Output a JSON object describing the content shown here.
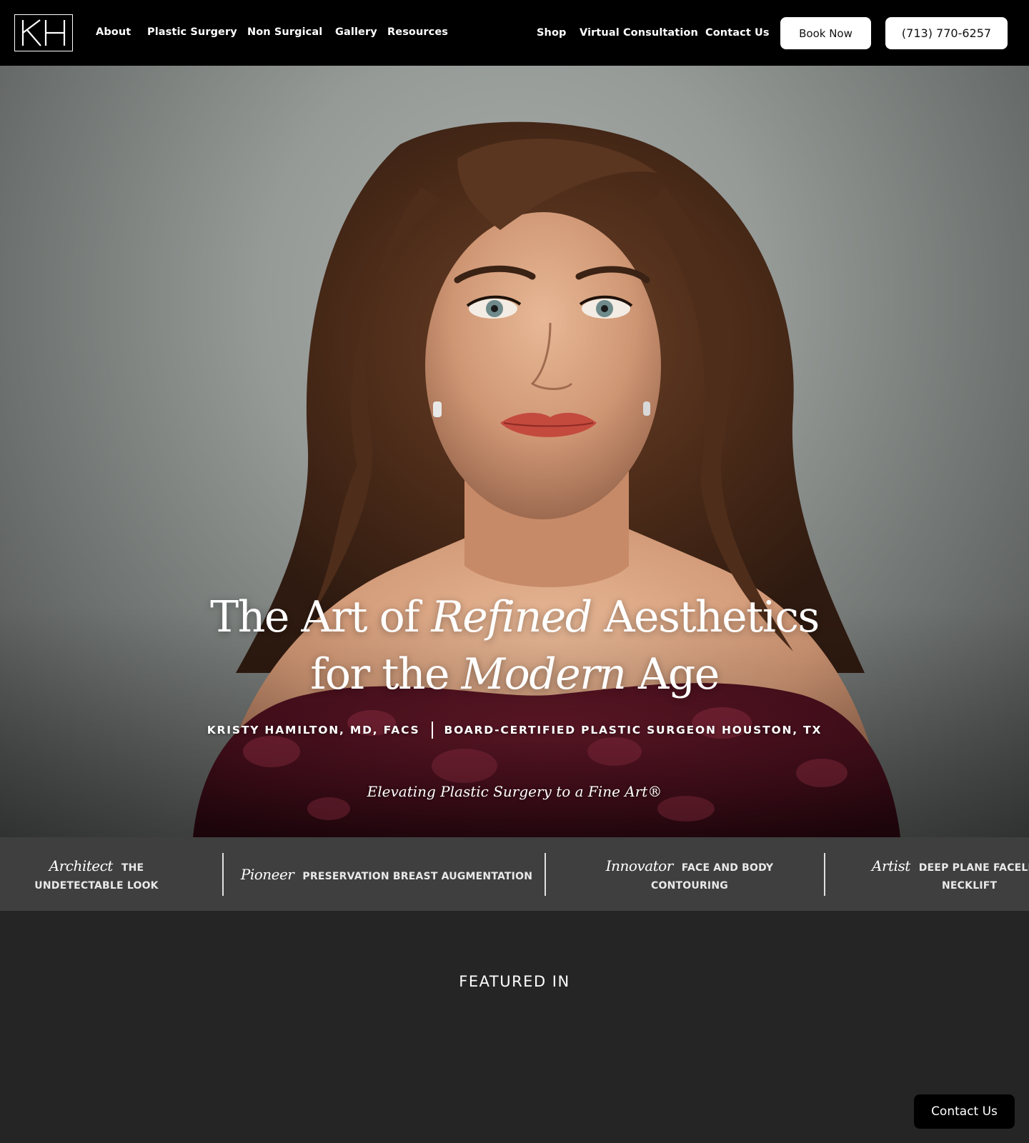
{
  "nav": {
    "logo_text": "KH",
    "links_left": [
      "About",
      "Plastic Surgery",
      "Non Surgical",
      "Gallery",
      "Resources"
    ],
    "links_right": [
      "Shop",
      "Virtual Consultation",
      "Contact Us"
    ],
    "book_label": "Book Now",
    "phone_label": "(713) 770-6257"
  },
  "hero": {
    "title_line1_a": "The Art of ",
    "title_line1_em": "Refined",
    "title_line1_b": " Aesthetics",
    "title_line2_a": "for the ",
    "title_line2_em": "Modern",
    "title_line2_b": " Age",
    "credential_name": "KRISTY HAMILTON, MD, FACS",
    "credential_title": "BOARD-CERTIFIED PLASTIC SURGEON HOUSTON, TX",
    "tagline": "Elevating Plastic Surgery to a Fine Art®"
  },
  "strip": {
    "items": [
      {
        "word": "Architect",
        "desc": "THE",
        "desc2": "UNDETECTABLE LOOK"
      },
      {
        "word": "Pioneer",
        "desc": "PRESERVATION BREAST AUGMENTATION",
        "desc2": ""
      },
      {
        "word": "Innovator",
        "desc": "FACE AND BODY",
        "desc2": "CONTOURING"
      },
      {
        "word": "Artist",
        "desc": "DEEP PLANE FACELIF",
        "desc2": "NECKLIFT"
      }
    ]
  },
  "featured": {
    "heading": "FEATURED IN"
  },
  "floating": {
    "contact_label": "Contact Us"
  },
  "colors": {
    "nav_bg": "#000000",
    "strip_bg": "#3f3f3f",
    "page_bg": "#252525",
    "dress": "#5a1624"
  }
}
